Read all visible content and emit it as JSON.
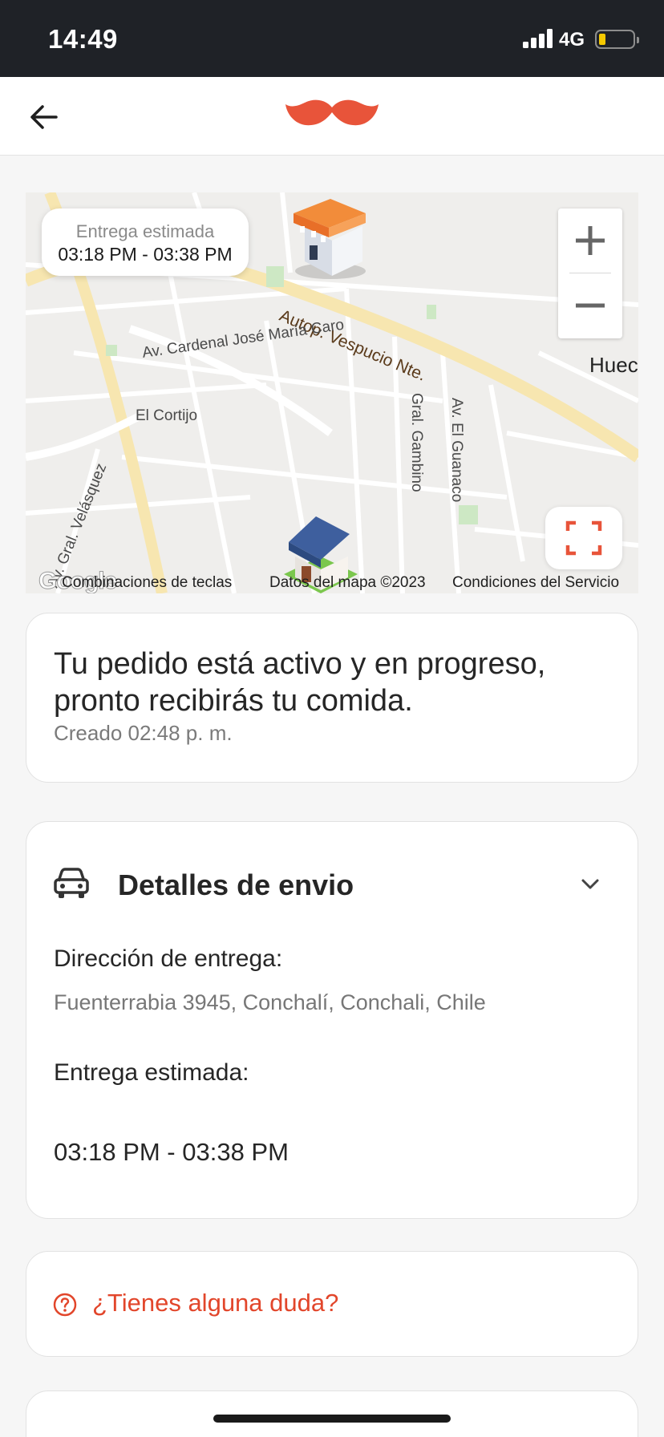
{
  "status_bar": {
    "time": "14:49",
    "network": "4G"
  },
  "header": {
    "logo": "mustache-logo"
  },
  "map": {
    "eta_label": "Entrega estimada",
    "eta_value": "03:18 PM - 03:38 PM",
    "streets": {
      "autop": "Autop. Vespucio Nte.",
      "cardenal": "Av. Cardenal José María Caro",
      "cortijo": "El Cortijo",
      "gambino": "Gral. Gambino",
      "guanaco": "Av. El Guanaco",
      "velasquez": "Av. Gral. Velásquez",
      "huec": "Huec"
    },
    "google": "Google",
    "attributions": {
      "keys": "Combinaciones de teclas",
      "data": "Datos del mapa ©2023",
      "terms": "Condiciones del Servicio"
    },
    "accent": "#e8543a"
  },
  "order_status": {
    "message": "Tu pedido está activo y en progreso, pronto recibirás tu comida.",
    "created": "Creado 02:48 p. m."
  },
  "shipping": {
    "title": "Detalles de envio",
    "address_label": "Dirección de entrega:",
    "address": "Fuenterrabia 3945, Conchalí, Conchali, Chile",
    "eta_label": "Entrega estimada:",
    "eta": "03:18 PM - 03:38 PM"
  },
  "help": {
    "label": "¿Tienes alguna duda?",
    "color": "#e2462b"
  }
}
